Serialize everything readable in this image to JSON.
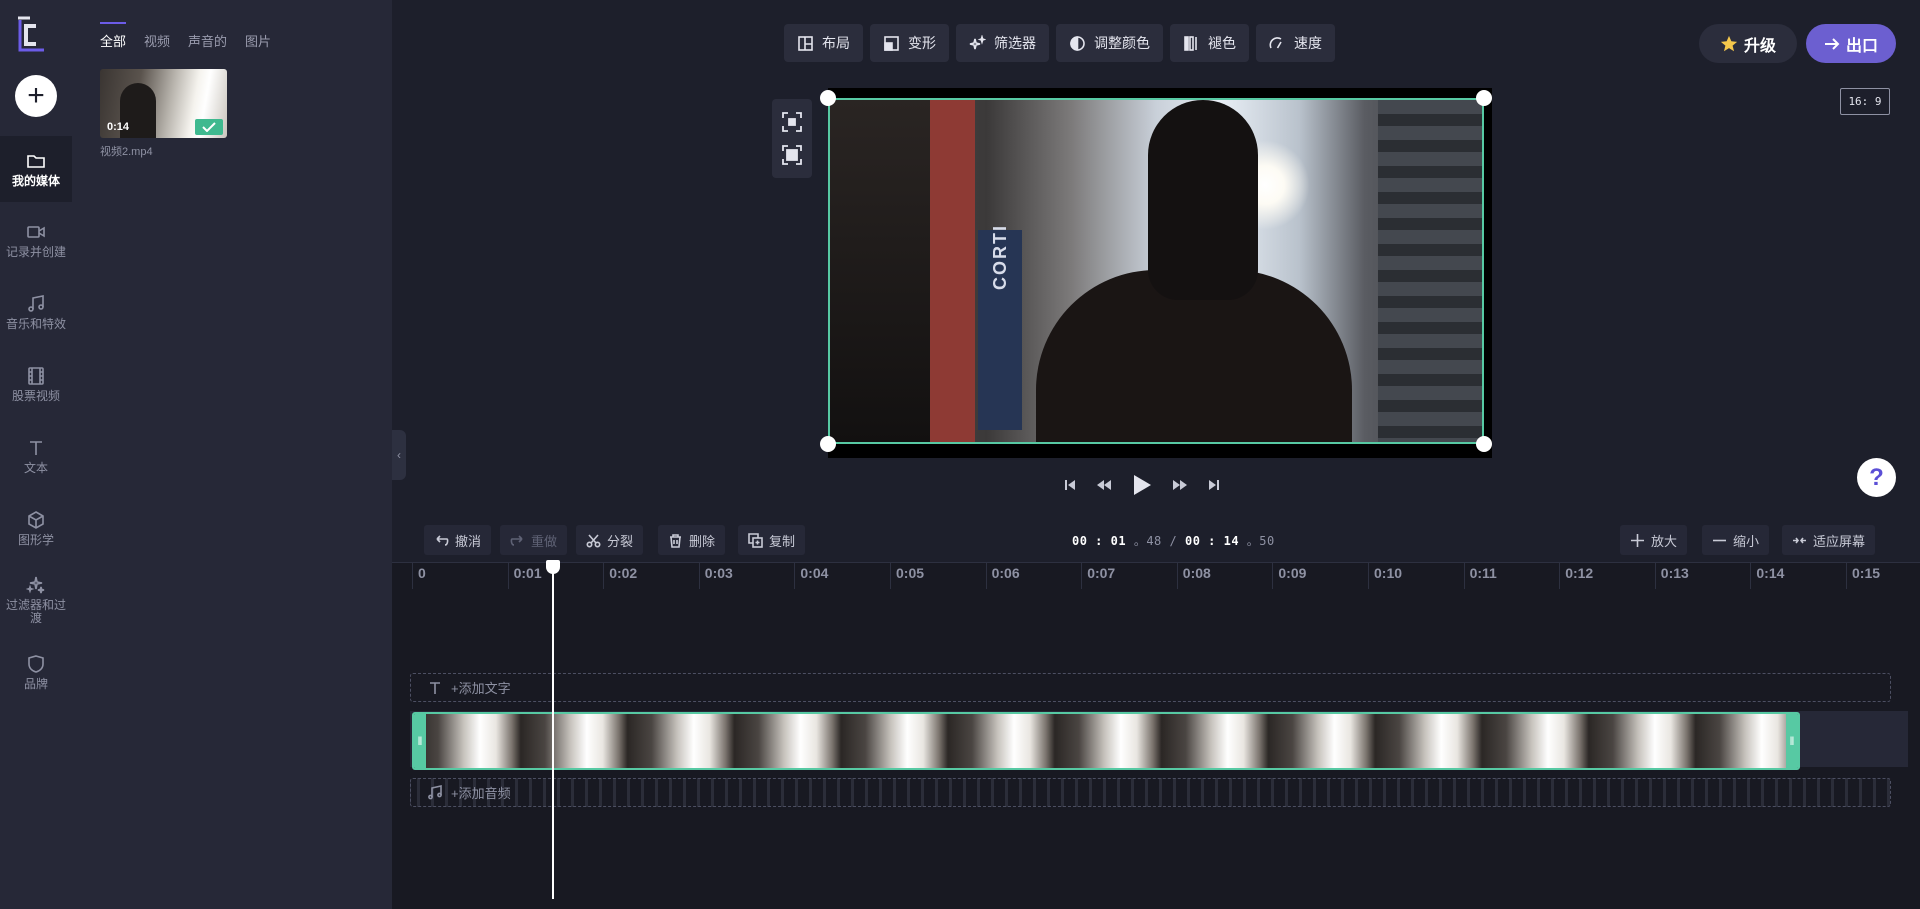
{
  "rail": {
    "items": [
      {
        "label": "我的媒体",
        "icon": "folder-icon"
      },
      {
        "label": "记录并创建",
        "icon": "camera-icon"
      },
      {
        "label": "音乐和特效",
        "icon": "music-icon"
      },
      {
        "label": "股票视频",
        "icon": "film-icon"
      },
      {
        "label": "文本",
        "icon": "text-icon"
      },
      {
        "label": "图形学",
        "icon": "cube-icon"
      },
      {
        "label": "过滤器和过渡",
        "icon": "sparkle-icon"
      },
      {
        "label": "品牌",
        "icon": "shield-icon"
      }
    ]
  },
  "media": {
    "tabs": [
      "全部",
      "视频",
      "声音的",
      "图片"
    ],
    "clip": {
      "duration": "0:14",
      "name": "视频2.mp4"
    }
  },
  "toolbar": {
    "buttons": [
      "布局",
      "变形",
      "筛选器",
      "调整颜色",
      "褪色",
      "速度"
    ]
  },
  "header": {
    "upgrade_label": "升级",
    "export_label": "出口",
    "aspect_ratio": "16: 9",
    "help_symbol": "?"
  },
  "preview": {
    "sign_text": "CORTI"
  },
  "timeline": {
    "undo": "撤消",
    "redo": "重做",
    "split": "分裂",
    "delete": "删除",
    "duplicate": "复制",
    "zoom_in": "放大",
    "zoom_out": "缩小",
    "fit": "适应屏幕",
    "time": {
      "cur_min": "00",
      "cur_sec": "01",
      "cur_frac": "48",
      "tot_min": "00",
      "tot_sec": "14",
      "tot_frac": "50"
    },
    "ticks": [
      "0",
      "0:01",
      "0:02",
      "0:03",
      "0:04",
      "0:05",
      "0:06",
      "0:07",
      "0:08",
      "0:09",
      "0:10",
      "0:11",
      "0:12",
      "0:13",
      "0:14",
      "0:15"
    ],
    "add_text": "+添加文字",
    "add_audio": "+添加音频"
  },
  "colors": {
    "accent": "#6c5fd0",
    "selection": "#57c9a3",
    "background": "#1d1f2b"
  }
}
